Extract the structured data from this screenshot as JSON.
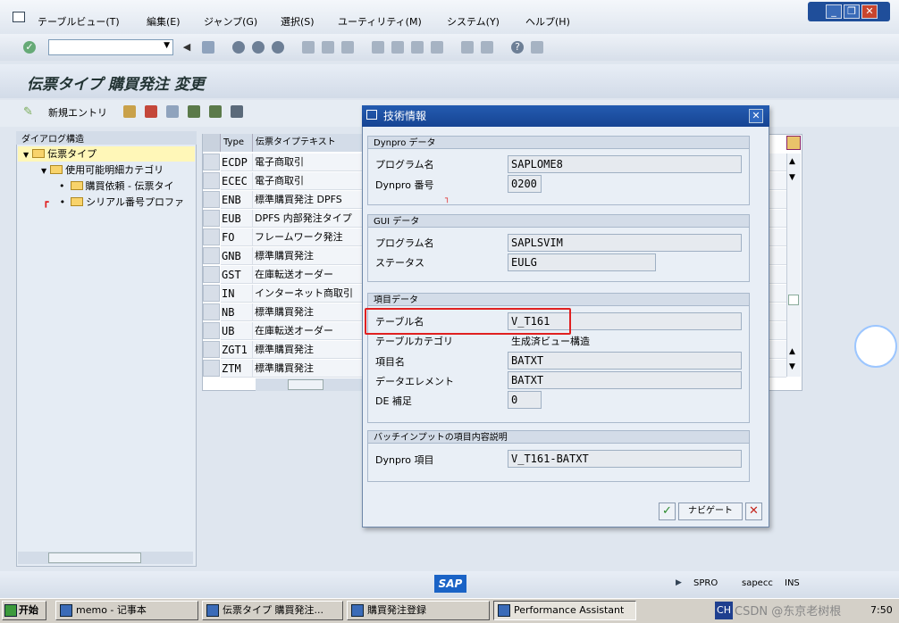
{
  "menu": {
    "items": [
      "テーブルビュー(T)",
      "編集(E)",
      "ジャンプ(G)",
      "選択(S)",
      "ユーティリティ(M)",
      "システム(Y)",
      "ヘルプ(H)"
    ]
  },
  "window_controls": {
    "minimize": "_",
    "restore": "❐",
    "close": "✕"
  },
  "page": {
    "title": "伝票タイプ 購買発注 変更"
  },
  "app_toolbar": {
    "new_entries": "新規エントリ"
  },
  "tree": {
    "header": "ダイアログ構造",
    "items": [
      {
        "label": "伝票タイプ"
      },
      {
        "label": "使用可能明細カテゴリ"
      },
      {
        "label": "購買依頼 - 伝票タイ"
      },
      {
        "label": "シリアル番号プロファ"
      }
    ]
  },
  "table": {
    "headers": [
      "Type",
      "伝票タイプテキスト"
    ],
    "rows": [
      {
        "type": "ECDP",
        "text": "電子商取引"
      },
      {
        "type": "ECEC",
        "text": "電子商取引"
      },
      {
        "type": "ENB",
        "text": "標準購買発注 DPFS"
      },
      {
        "type": "EUB",
        "text": "DPFS 内部発注タイプ"
      },
      {
        "type": "FO",
        "text": "フレームワーク発注"
      },
      {
        "type": "GNB",
        "text": "標準購買発注"
      },
      {
        "type": "GST",
        "text": "在庫転送オーダー"
      },
      {
        "type": "IN",
        "text": "インターネット商取引"
      },
      {
        "type": "NB",
        "text": "標準購買発注"
      },
      {
        "type": "UB",
        "text": "在庫転送オーダー"
      },
      {
        "type": "ZGT1",
        "text": "標準購買発注"
      },
      {
        "type": "ZTM",
        "text": "標準購買発注"
      }
    ]
  },
  "dialog": {
    "title": "技術情報",
    "dynpro": {
      "header": "Dynpro データ",
      "program_label": "プログラム名",
      "program": "SAPLOME8",
      "number_label": "Dynpro 番号",
      "number": "0200"
    },
    "gui": {
      "header": "GUI データ",
      "program_label": "プログラム名",
      "program": "SAPLSVIM",
      "status_label": "ステータス",
      "status": "EULG"
    },
    "field": {
      "header": "項目データ",
      "table_label": "テーブル名",
      "table": "V_T161",
      "category_label": "テーブルカテゴリ",
      "category": "生成済ビュー構造",
      "field_label": "項目名",
      "field": "BATXT",
      "element_label": "データエレメント",
      "element": "BATXT",
      "de_label": "DE 補足",
      "de": "0"
    },
    "batch": {
      "header": "バッチインプットの項目内容説明",
      "dynpro_label": "Dynpro 項目",
      "dynpro_field": "V_T161-BATXT"
    },
    "navigate": "ナビゲート"
  },
  "status": {
    "transaction": "SPRO",
    "server": "sapecc",
    "mode": "INS",
    "logo": "SAP"
  },
  "taskbar": {
    "start": "开始",
    "tasks": [
      "memo - 记事本",
      "伝票タイプ 購買発注...",
      "購買発注登録",
      "Performance Assistant"
    ],
    "lang": "CH",
    "watermark": "CSDN @东京老树根",
    "clock": "7:50"
  }
}
